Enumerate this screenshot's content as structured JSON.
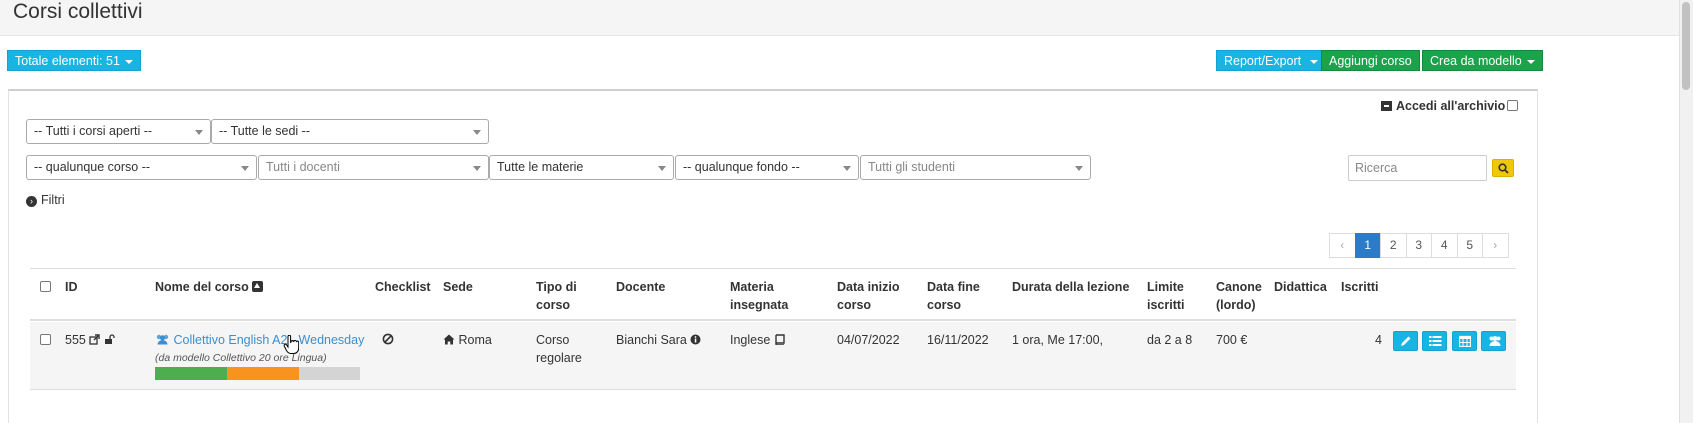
{
  "page": {
    "title": "Corsi collettivi"
  },
  "toolbar": {
    "total_label": "Totale elementi: 51",
    "report_label": "Report/Export",
    "add_label": "Aggiungi corso",
    "template_label": "Crea da modello"
  },
  "filters": {
    "status": "-- Tutti i corsi aperti --",
    "locations": "-- Tutte le sedi --",
    "course": "-- qualunque corso --",
    "teachers": "Tutti i docenti",
    "subjects": "Tutte le materie",
    "fund": "-- qualunque fondo --",
    "students": "Tutti gli studenti",
    "archive_label": "Accedi all'archivio",
    "search_placeholder": "Ricerca",
    "filters_label": "Filtri"
  },
  "pagination": {
    "prev": "‹",
    "pages": [
      "1",
      "2",
      "3",
      "4",
      "5"
    ],
    "next": "›",
    "active": "1"
  },
  "table": {
    "headers": {
      "id": "ID",
      "name": "Nome del corso",
      "checklist": "Checklist",
      "location": "Sede",
      "type_1": "Tipo di",
      "type_2": "corso",
      "teacher": "Docente",
      "subject_1": "Materia",
      "subject_2": "insegnata",
      "start_1": "Data inizio",
      "start_2": "corso",
      "end_1": "Data fine",
      "end_2": "corso",
      "duration": "Durata della lezione",
      "limit_1": "Limite",
      "limit_2": "iscritti",
      "fee_1": "Canone",
      "fee_2": "(lordo)",
      "teaching": "Didattica",
      "enrolled": "Iscritti"
    },
    "rows": [
      {
        "id": "555",
        "name": "Collettivo English A2 - Wednesday",
        "template": "(da modello Collettivo 20 ore Lingua)",
        "location": "Roma",
        "type_1": "Corso",
        "type_2": "regolare",
        "teacher": "Bianchi Sara",
        "subject": "Inglese",
        "start": "04/07/2022",
        "end": "16/11/2022",
        "duration": "1 ora, Me 17:00,",
        "limit": "da 2 a 8",
        "fee": "700 €",
        "enrolled": "4",
        "progress": {
          "green": 0.35,
          "orange": 0.35
        }
      }
    ]
  },
  "colors": {
    "info": "#17b4e4",
    "success": "#1aa34a",
    "warning": "#f0c808",
    "primary": "#2b7bc8"
  }
}
